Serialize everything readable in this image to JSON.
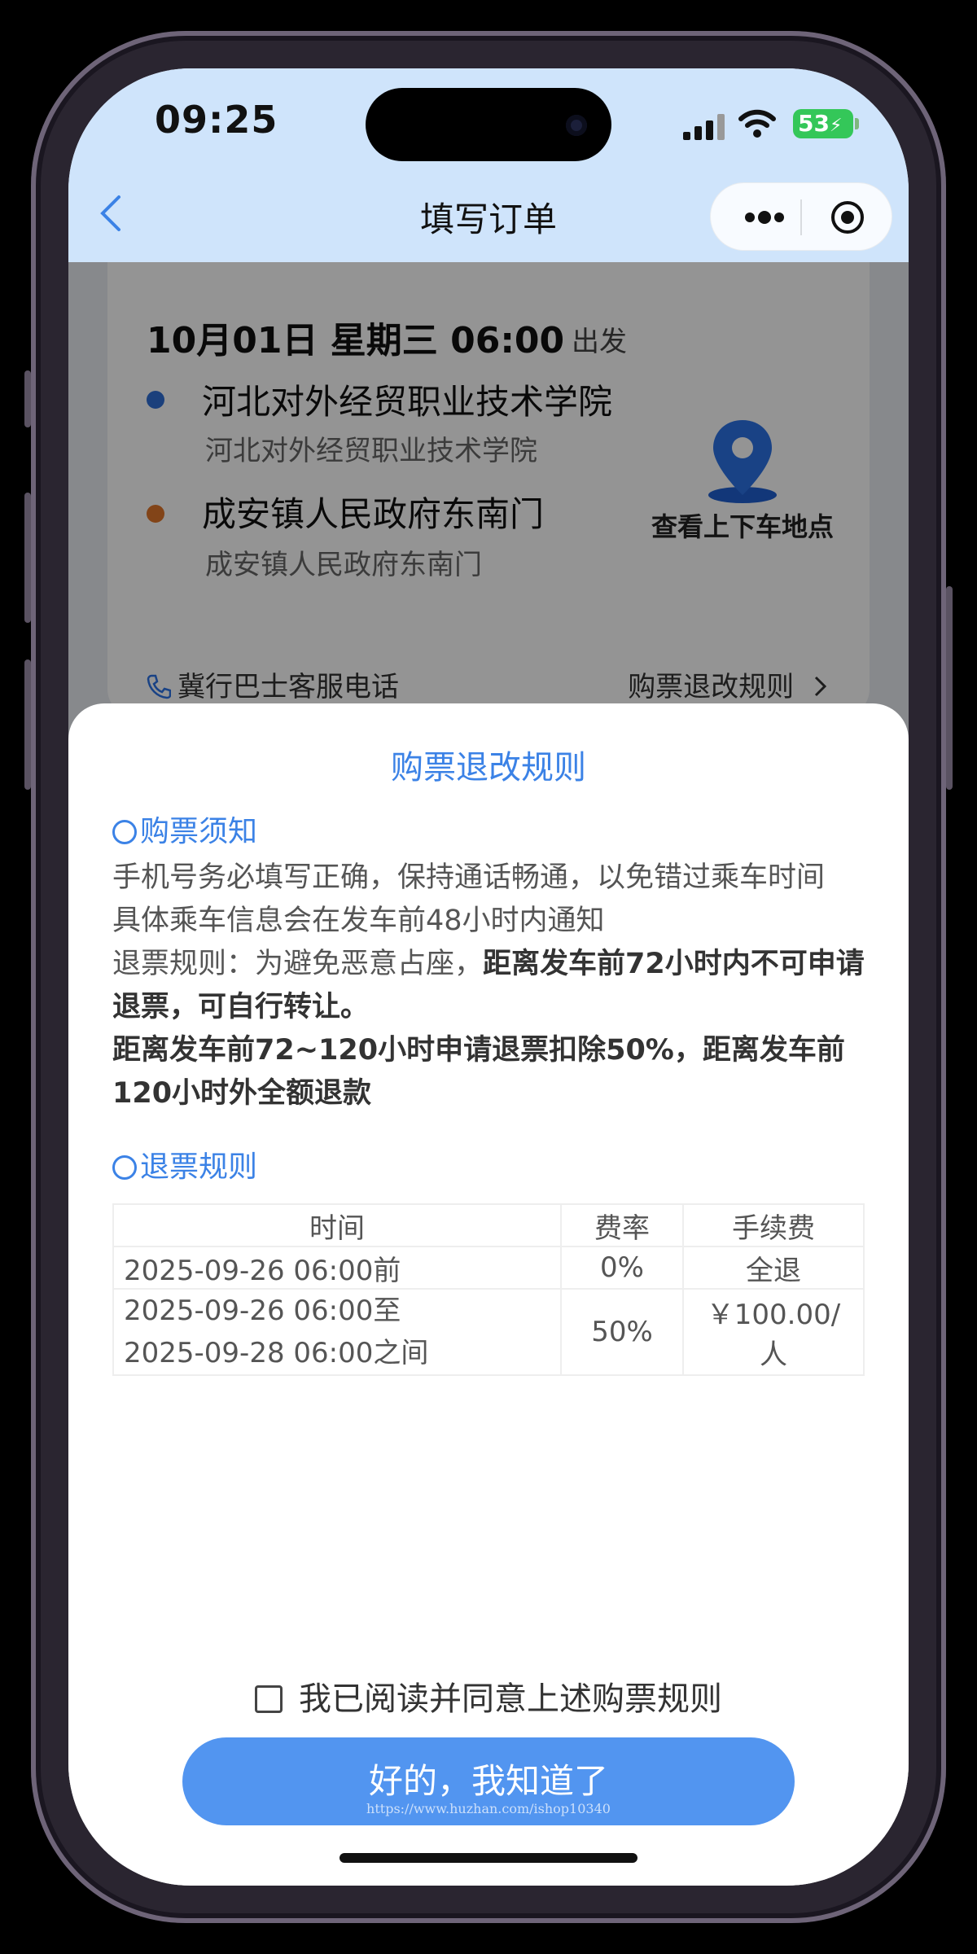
{
  "status": {
    "time": "09:25",
    "battery": "53"
  },
  "nav": {
    "title": "填写订单"
  },
  "card": {
    "date": "10月01日 星期三 06:00",
    "depart_label": "出发",
    "origin": {
      "name": "河北对外经贸职业技术学院",
      "sub": "河北对外经贸职业技术学院"
    },
    "destination": {
      "name": "成安镇人民政府东南门",
      "sub": "成安镇人民政府东南门"
    },
    "pickup_label": "查看上下车地点",
    "phone_label": "冀行巴士客服电话",
    "rules_link": "购票退改规则"
  },
  "sheet": {
    "title": "购票退改规则",
    "notice_heading": "购票须知",
    "notice_line1": "手机号务必填写正确，保持通话畅通，以免错过乘车时间",
    "notice_line2": "具体乘车信息会在发车前48小时内通知",
    "refund_rule_prefix": "退票规则：为避免恶意占座，",
    "refund_rule_bold1": "距离发车前72小时内不可申请退票，可自行转让。",
    "refund_rule_bold2": "距离发车前72~120小时申请退票扣除50%，距离发车前120小时外全额退款",
    "refund_heading": "退票规则",
    "table": {
      "headers": [
        "时间",
        "费率",
        "手续费"
      ],
      "rows": [
        {
          "time": "2025-09-26 06:00前",
          "rate": "0%",
          "fee": "全退"
        },
        {
          "time_line1": "2025-09-26 06:00至",
          "time_line2": "2025-09-28 06:00之间",
          "rate": "50%",
          "fee": "￥100.00/人"
        }
      ]
    },
    "agree_label": "我已阅读并同意上述购票规则",
    "confirm_button": "好的，我知道了",
    "watermark": "https://www.huzhan.com/ishop10340"
  },
  "colors": {
    "accent": "#3b82e6",
    "button": "#5295f0",
    "origin_dot": "#2f6fd6",
    "dest_dot": "#e0762a",
    "header_bg": "#cfe4fb"
  }
}
